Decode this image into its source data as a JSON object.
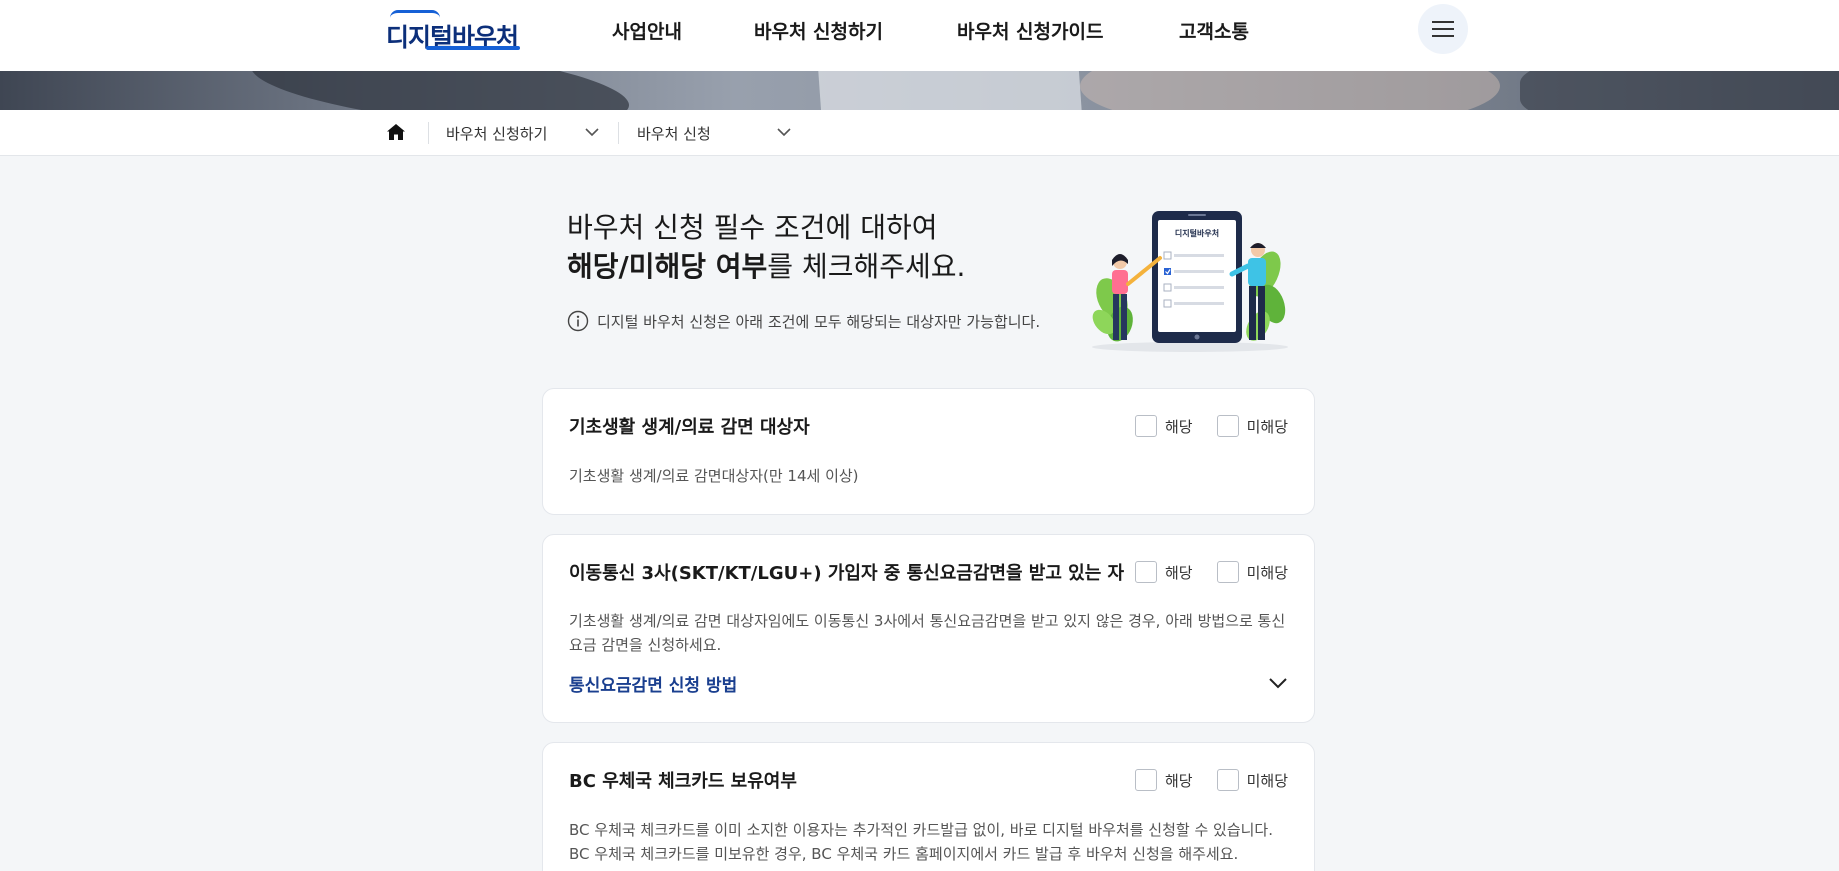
{
  "header": {
    "logo_text": "디지털바우처",
    "nav": [
      "사업안내",
      "바우처 신청하기",
      "바우처 신청가이드",
      "고객소통"
    ]
  },
  "breadcrumb": {
    "level1": "바우처 신청하기",
    "level2": "바우처 신청"
  },
  "intro": {
    "title_line1": "바우처 신청 필수 조건에 대하여",
    "title_line2_bold": "해당/미해당 여부",
    "title_line2_rest": "를 체크해주세요.",
    "note": "디지털 바우처 신청은 아래 조건에 모두 해당되는 대상자만 가능합니다.",
    "illustration_text": "디지털바우처"
  },
  "check_labels": {
    "yes": "해당",
    "no": "미해당"
  },
  "cards": [
    {
      "title": "기초생활 생계/의료 감면 대상자",
      "desc": "기초생활 생계/의료 감면대상자(만 14세 이상)"
    },
    {
      "title": "이동통신 3사(SKT/KT/LGU+) 가입자 중 통신요금감면을 받고 있는 자",
      "desc": "기초생활 생계/의료 감면 대상자임에도 이동통신 3사에서 통신요금감면을 받고 있지 않은 경우, 아래 방법으로 통신요금 감면을 신청하세요.",
      "accordion": "통신요금감면 신청 방법"
    },
    {
      "title": "BC 우체국 체크카드 보유여부",
      "desc_line1": "BC 우체국 체크카드를 이미 소지한 이용자는 추가적인 카드발급 없이, 바로 디지털 바우처를 신청할 수 있습니다.",
      "desc_line2": "BC 우체국 체크카드를 미보유한 경우, BC 우체국 카드 홈페이지에서 카드 발급 후 바우처 신청을 해주세요."
    }
  ],
  "colors": {
    "brand": "#0c2f7a",
    "accent": "#1560d6",
    "link": "#1a3f8f"
  }
}
